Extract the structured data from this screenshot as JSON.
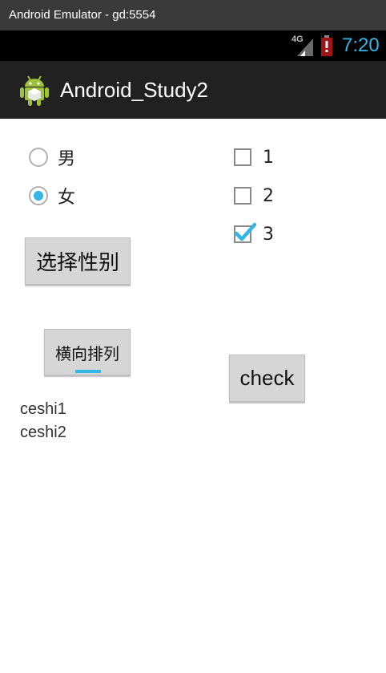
{
  "window": {
    "title": "Android Emulator - gd:5554"
  },
  "status_bar": {
    "network_type": "4G",
    "time": "7:20",
    "clock_color": "#33b5e5"
  },
  "action_bar": {
    "app_title": "Android_Study2"
  },
  "gender_radios": [
    {
      "label": "男",
      "checked": false
    },
    {
      "label": "女",
      "checked": true
    }
  ],
  "checkboxes": [
    {
      "label": "1",
      "checked": false
    },
    {
      "label": "2",
      "checked": false
    },
    {
      "label": "3",
      "checked": true
    }
  ],
  "buttons": {
    "select_gender": "选择性别",
    "horizontal_arrange": "横向排列",
    "check": "check"
  },
  "text_lines": [
    "ceshi1",
    "ceshi2"
  ],
  "accent_color": "#33b5e5"
}
